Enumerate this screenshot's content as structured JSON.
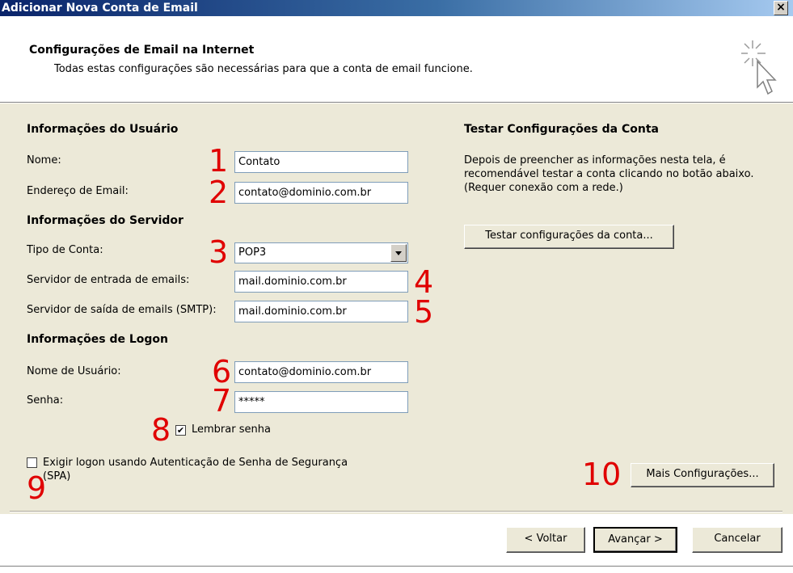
{
  "window": {
    "title": "Adicionar Nova Conta de Email",
    "close_label": "×"
  },
  "header": {
    "heading": "Configurações de Email na Internet",
    "subheading": "Todas estas configurações são necessárias para que a conta de email funcione."
  },
  "user_info": {
    "section_title": "Informações do Usuário",
    "name_label": "Nome:",
    "name_value": "Contato",
    "email_label": "Endereço de Email:",
    "email_value": "contato@dominio.com.br"
  },
  "server_info": {
    "section_title": "Informações do Servidor",
    "account_type_label": "Tipo de Conta:",
    "account_type_value": "POP3",
    "incoming_label": "Servidor de entrada de emails:",
    "incoming_value": "mail.dominio.com.br",
    "outgoing_label": "Servidor de saída de emails (SMTP):",
    "outgoing_value": "mail.dominio.com.br"
  },
  "logon_info": {
    "section_title": "Informações de Logon",
    "username_label": "Nome de Usuário:",
    "username_value": "contato@dominio.com.br",
    "password_label": "Senha:",
    "password_value": "*****",
    "remember_label": "Lembrar senha",
    "remember_checked": true,
    "spa_label_line1": "Exigir logon usando Autenticação de Senha de Segurança",
    "spa_label_line2": "(SPA)",
    "spa_checked": false
  },
  "test_settings": {
    "section_title": "Testar Configurações da Conta",
    "desc_line1": "Depois de preencher as informações nesta tela, é",
    "desc_line2": "recomendável testar a conta clicando no botão abaixo.",
    "desc_line3": "(Requer conexão com a rede.)",
    "test_button": "Testar configurações da conta..."
  },
  "more_settings_button": "Mais Configurações...",
  "footer": {
    "back_button": "< Voltar",
    "next_button": "Avançar >",
    "cancel_button": "Cancelar"
  },
  "markers": [
    "1",
    "2",
    "3",
    "4",
    "5",
    "6",
    "7",
    "8",
    "9",
    "10"
  ],
  "colors": {
    "marker": "#e00000",
    "titlebar_start": "#0a246a",
    "panel_bg": "#ece9d8"
  }
}
